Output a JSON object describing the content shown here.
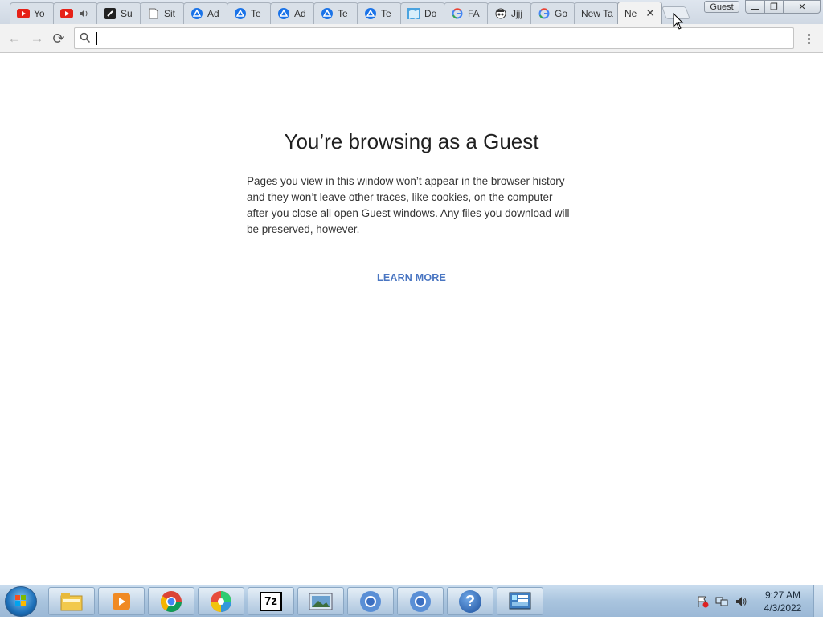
{
  "tabs": [
    {
      "label": "Yo",
      "icon": "youtube-icon"
    },
    {
      "label": "",
      "icon": "youtube-icon",
      "audio": true
    },
    {
      "label": "Su",
      "icon": "app-icon"
    },
    {
      "label": "Sit",
      "icon": "page-icon"
    },
    {
      "label": "Ad",
      "icon": "drive-icon"
    },
    {
      "label": "Te",
      "icon": "drive-icon"
    },
    {
      "label": "Ad",
      "icon": "drive-icon"
    },
    {
      "label": "Te",
      "icon": "drive-icon"
    },
    {
      "label": "Te",
      "icon": "drive-icon"
    },
    {
      "label": "Do",
      "icon": "map-icon"
    },
    {
      "label": "FA",
      "icon": "google-icon"
    },
    {
      "label": "Jjjj",
      "icon": "incognito-icon"
    },
    {
      "label": "Go",
      "icon": "google-icon"
    },
    {
      "label": "New Ta",
      "icon": ""
    },
    {
      "label": "Ne",
      "icon": "",
      "active": true
    }
  ],
  "window": {
    "profile_badge": "Guest",
    "minimize": "—",
    "restore": "❐",
    "close": "✕"
  },
  "toolbar": {
    "back": "←",
    "forward": "→",
    "reload": "⟳",
    "omnibox_value": "",
    "omnibox_placeholder": ""
  },
  "content": {
    "title": "You’re browsing as a Guest",
    "description": "Pages you view in this window won’t appear in the browser history and they won’t leave other traces, like cookies, on the computer after you close all open Guest windows. Any files you download will be preserved, however.",
    "learn_more": "LEARN MORE"
  },
  "taskbar": {
    "apps": [
      "file-explorer-icon",
      "media-player-icon",
      "chrome-icon",
      "photos-icon",
      "7zip-icon",
      "picture-viewer-icon",
      "chromium-icon",
      "chromium-icon",
      "help-icon",
      "control-panel-icon"
    ],
    "zip_label": "7z",
    "help_label": "?",
    "time": "9:27 AM",
    "date": "4/3/2022"
  },
  "colors": {
    "link": "#4a76c2",
    "title": "#202020",
    "taskbar": "#a9c4de"
  }
}
